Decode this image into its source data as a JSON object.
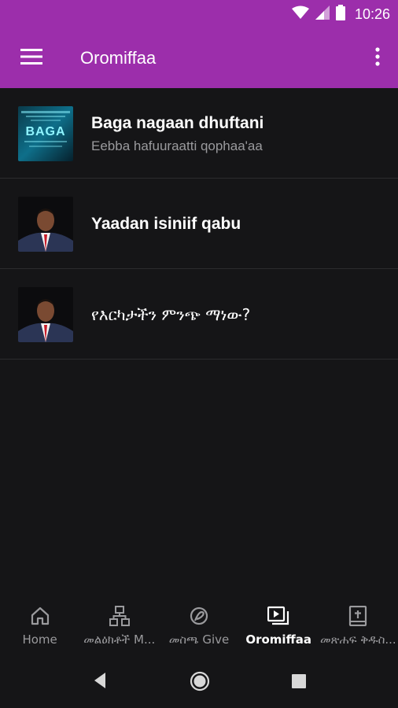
{
  "status_bar": {
    "time": "10:26"
  },
  "app_bar": {
    "title": "Oromiffaa"
  },
  "list": [
    {
      "title": "Baga nagaan dhuftani",
      "subtitle": "Eebba hafuuraatti qophaa'aa",
      "thumb_text": "BAGA"
    },
    {
      "title": "Yaadan isiniif qabu",
      "subtitle": ""
    },
    {
      "title": "የእርካታችን ምንጭ ማነው?",
      "subtitle": ""
    }
  ],
  "bottom_nav": [
    {
      "label": "Home",
      "icon": "home-icon",
      "active": false
    },
    {
      "label": "መልዕክቶች M...",
      "icon": "sitemap-icon",
      "active": false
    },
    {
      "label": "መስጫ Give",
      "icon": "give-icon",
      "active": false
    },
    {
      "label": "Oromiffaa",
      "icon": "video-library-icon",
      "active": true
    },
    {
      "label": "መጽሐፍ ቅዱስ...",
      "icon": "bible-icon",
      "active": false
    }
  ],
  "colors": {
    "primary": "#9c2eab",
    "background": "#151517",
    "secondary_text": "#9a9a9d"
  }
}
